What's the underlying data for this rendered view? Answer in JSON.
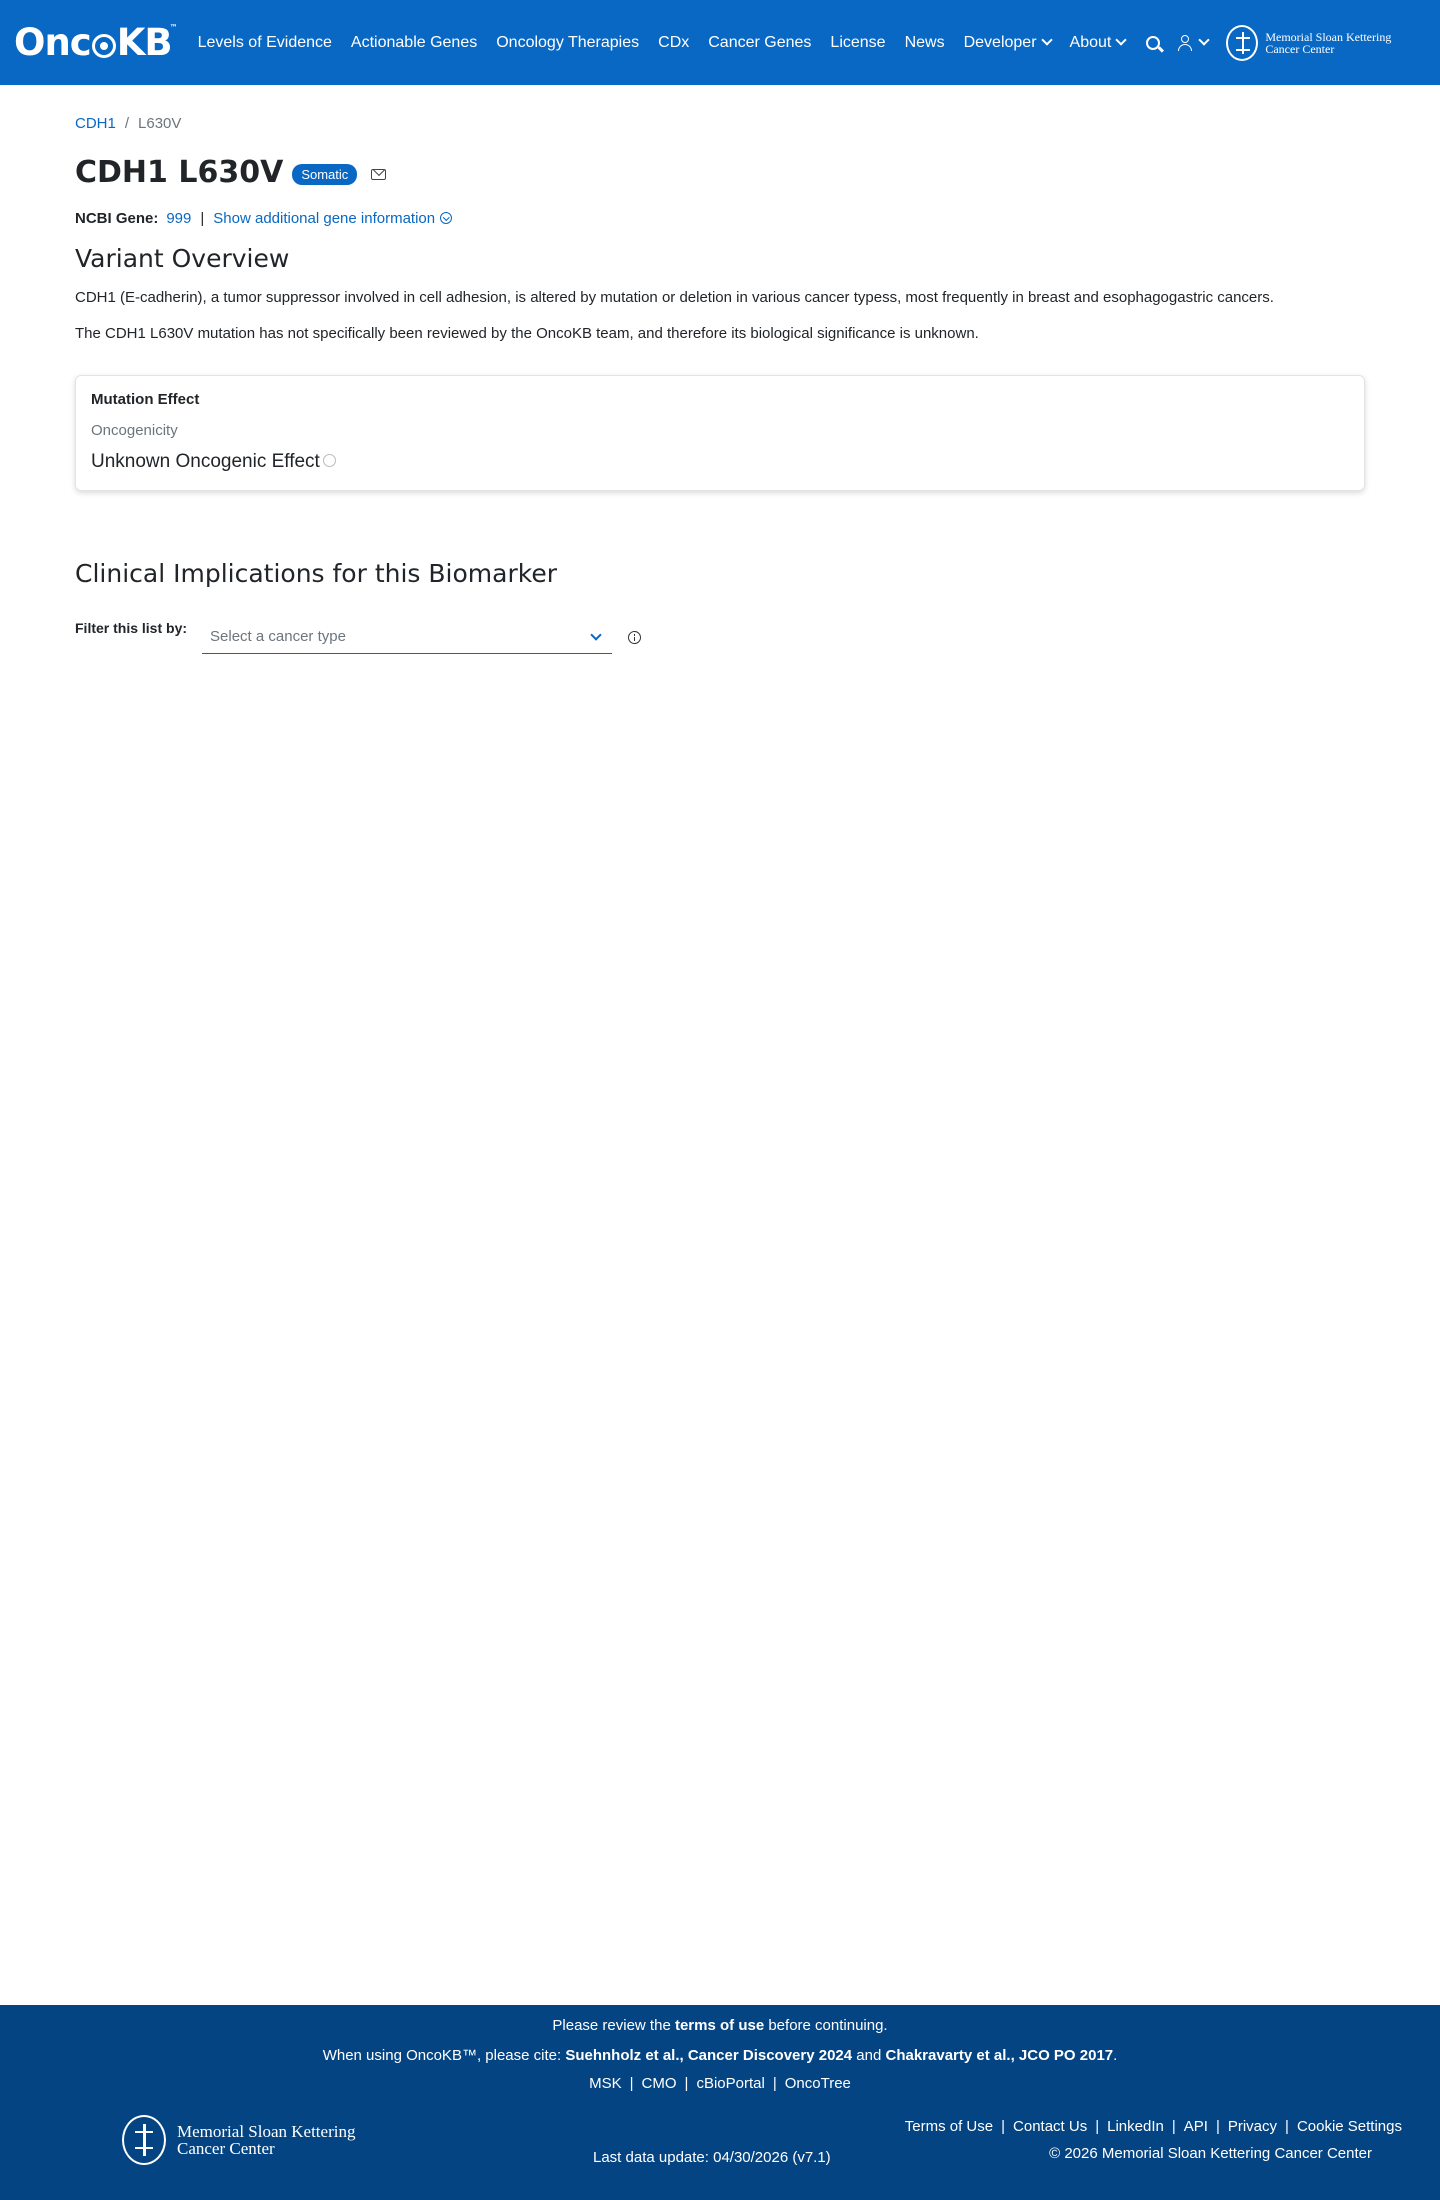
{
  "nav": {
    "logo": "OncoKB",
    "logo_tm": "™",
    "items": [
      {
        "label": "Levels of Evidence"
      },
      {
        "label": "Actionable Genes"
      },
      {
        "label": "Oncology Therapies"
      },
      {
        "label": "CDx"
      },
      {
        "label": "Cancer Genes"
      },
      {
        "label": "License"
      },
      {
        "label": "News"
      },
      {
        "label": "Developer"
      },
      {
        "label": "About"
      }
    ],
    "msk_line1": "Memorial Sloan Kettering",
    "msk_line2": "Cancer Center"
  },
  "breadcrumb": {
    "gene": "CDH1",
    "separator": "/",
    "current": "L630V"
  },
  "header": {
    "title": "CDH1 L630V",
    "badge": "Somatic",
    "ncbi_label": "NCBI Gene:",
    "ncbi_value": "999",
    "pipe": "|",
    "more_info": "Show additional gene information"
  },
  "overview": {
    "heading": "Variant Overview",
    "p1": "CDH1 (E-cadherin), a tumor suppressor involved in cell adhesion, is altered by mutation or deletion in various cancer typess, most frequently in breast and esophagogastric cancers.",
    "p2": "The CDH1 L630V mutation has not specifically been reviewed by the OncoKB team, and therefore its biological significance is unknown."
  },
  "mutation_effect": {
    "title": "Mutation Effect",
    "subtitle": "Oncogenicity",
    "value": "Unknown Oncogenic Effect"
  },
  "clinical": {
    "heading": "Clinical Implications for this Biomarker",
    "filter_label": "Filter this list by:",
    "select_placeholder": "Select a cancer type"
  },
  "footer": {
    "review_pre": "Please review the ",
    "review_link": "terms of use",
    "review_post": " before continuing.",
    "cite_pre": "When using OncoKB™, please cite: ",
    "cite_1": "Suehnholz et al., Cancer Discovery 2024",
    "cite_and": " and ",
    "cite_2": "Chakravarty et al., JCO PO 2017",
    "cite_end": ".",
    "links": [
      {
        "label": "MSK"
      },
      {
        "label": "CMO"
      },
      {
        "label": "cBioPortal"
      },
      {
        "label": "OncoTree"
      }
    ],
    "msk_line1": "Memorial Sloan Kettering",
    "msk_line2": "Cancer Center",
    "last_update": "Last data update: 04/30/2026 (v7.1)",
    "right_links": [
      {
        "label": "Terms of Use"
      },
      {
        "label": "Contact Us"
      },
      {
        "label": "LinkedIn"
      },
      {
        "label": "API"
      },
      {
        "label": "Privacy"
      },
      {
        "label": "Cookie Settings"
      }
    ],
    "link_sep": "|",
    "copyright": "© 2026 Memorial Sloan Kettering Cancer Center"
  },
  "colors": {
    "brand": "#0968c3",
    "footer_bg": "#054482"
  }
}
